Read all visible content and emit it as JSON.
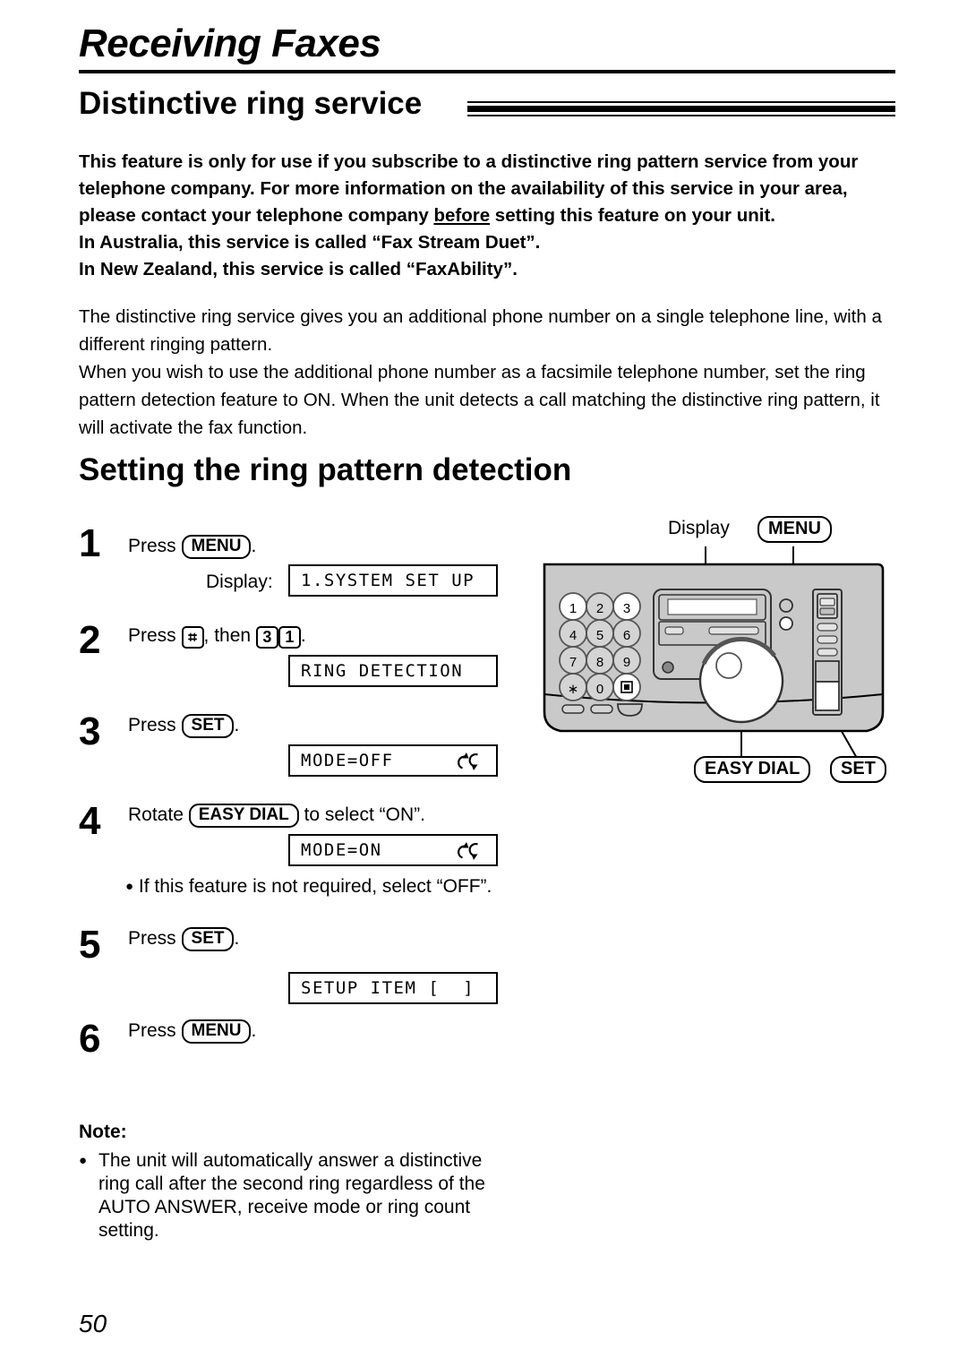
{
  "page": {
    "title": "Receiving Faxes",
    "number": "50"
  },
  "section": {
    "heading": "Distinctive ring service"
  },
  "intro": {
    "line1": "This feature is only for use if you subscribe to a distinctive ring pattern service from your",
    "line2": "telephone company. For more information on the availability of this service in your area,",
    "line3_a": "please contact your telephone company ",
    "line3_underlined": "before",
    "line3_b": " setting this feature on your unit.",
    "line4": "In Australia, this service is called “Fax Stream Duet”.",
    "line5": "In New Zealand, this service is called “FaxAbility”."
  },
  "body": {
    "para1": "The distinctive ring service gives you an additional phone number on a single telephone line, with a different ringing pattern.",
    "para2": "When you wish to use the additional phone number as a facsimile telephone number, set the ring pattern detection feature to ON. When the unit detects a call matching the distinctive ring pattern, it will activate the fax function."
  },
  "procedure": {
    "heading": "Setting the ring pattern detection",
    "steps": [
      {
        "number": "1",
        "text_before": "Press",
        "key": "MENU",
        "text_after": ".",
        "display_label": "Display:",
        "lcd": "1.SYSTEM SET UP"
      },
      {
        "number": "2",
        "text_before": "Press",
        "key_hash": "⌗",
        "text_middle": ", then",
        "key_digit1": "3",
        "key_digit2": "1",
        "text_after": ".",
        "lcd": "RING DETECTION"
      },
      {
        "number": "3",
        "text_before": "Press",
        "key": "SET",
        "text_after": ".",
        "lcd": "MODE=OFF",
        "lcd_has_rotate_icon": true
      },
      {
        "number": "4",
        "text_before": "Rotate",
        "key": "EASY DIAL",
        "text_after": "to select “ON”.",
        "lcd": "MODE=ON",
        "lcd_has_rotate_icon": true,
        "bullet": "If this feature is not required, select “OFF”."
      },
      {
        "number": "5",
        "text_before": "Press",
        "key": "SET",
        "text_after": ".",
        "lcd": "SETUP ITEM [  ]"
      },
      {
        "number": "6",
        "text_before": "Press",
        "key": "MENU",
        "text_after": "."
      }
    ]
  },
  "note": {
    "heading": "Note:",
    "item": "The unit will automatically answer a distinctive ring call after the second ring regardless of the AUTO ANSWER, receive mode or ring count setting."
  },
  "figure": {
    "callouts": {
      "display": "Display",
      "menu": "MENU",
      "easy_dial": "EASY DIAL",
      "set": "SET"
    },
    "keypad": [
      [
        "1",
        "2",
        "3"
      ],
      [
        "4",
        "5",
        "6"
      ],
      [
        "7",
        "8",
        "9"
      ],
      [
        "∗",
        "0",
        "▣"
      ]
    ],
    "colors": {
      "panel": "#c9c9c9",
      "outline": "#000000",
      "lcd": "#ffffff",
      "key_fill": "#d4d4d4"
    }
  }
}
